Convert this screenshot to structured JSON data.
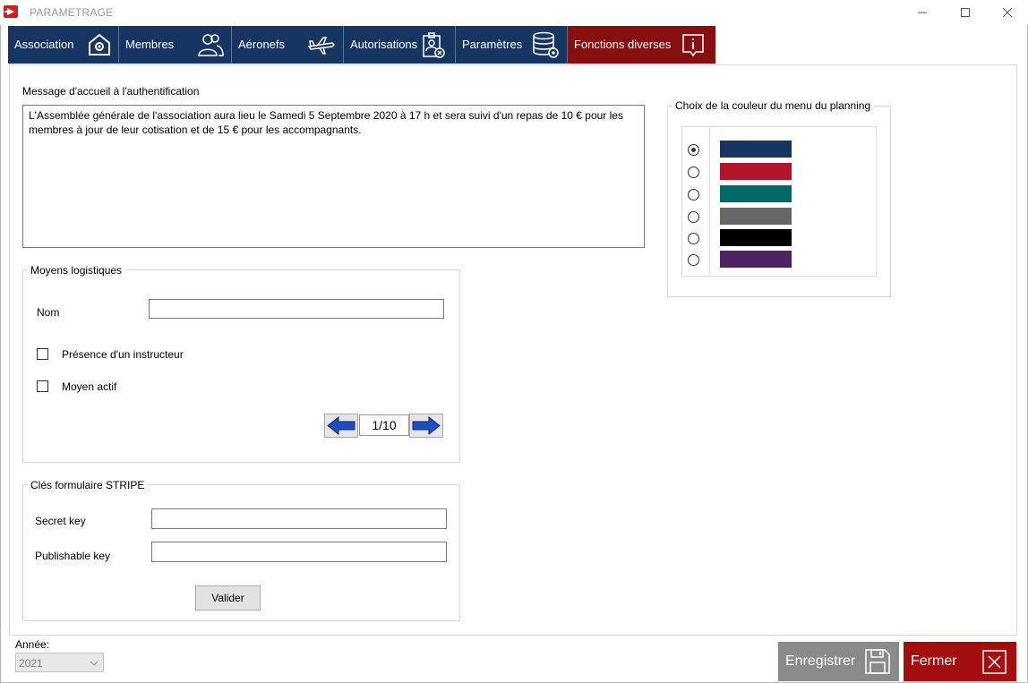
{
  "window": {
    "title": "PARAMETRAGE"
  },
  "nav": {
    "tabs": [
      {
        "label": "Association"
      },
      {
        "label": "Membres"
      },
      {
        "label": "Aéronefs"
      },
      {
        "label": "Autorisations"
      },
      {
        "label": "Paramètres"
      },
      {
        "label": "Fonctions diverses"
      }
    ]
  },
  "welcome": {
    "label": "Message d'accueil à l'authentification",
    "text": "L'Assemblée générale de l'association aura lieu le Samedi 5 Septembre 2020 à 17 h et sera suivi d'un repas de 10 € pour les membres à jour de leur cotisation et de 15 € pour les accompagnants."
  },
  "logistics": {
    "title": "Moyens logistiques",
    "name_label": "Nom",
    "name_value": "",
    "instructor_label": "Présence d'un instructeur",
    "active_label": "Moyen actif",
    "pager": "1/10"
  },
  "stripe": {
    "title": "Clés formulaire STRIPE",
    "secret_label": "Secret key",
    "publishable_label": "Publishable key",
    "secret_value": "",
    "publishable_value": "",
    "validate_label": "Valider"
  },
  "planning_color": {
    "title": "Choix de la couleur du menu du planning",
    "selected_index": 0,
    "colors": [
      "#163560",
      "#b3162b",
      "#006b66",
      "#666666",
      "#000000",
      "#4d2362"
    ]
  },
  "year": {
    "label": "Année:",
    "value": "2021"
  },
  "footer": {
    "save_label": "Enregistrer",
    "close_label": "Fermer"
  },
  "theme": {
    "nav_blue": "#163560",
    "nav_red": "#870f0f",
    "save_gray": "#8a8a8a",
    "close_red": "#a50e0e"
  }
}
